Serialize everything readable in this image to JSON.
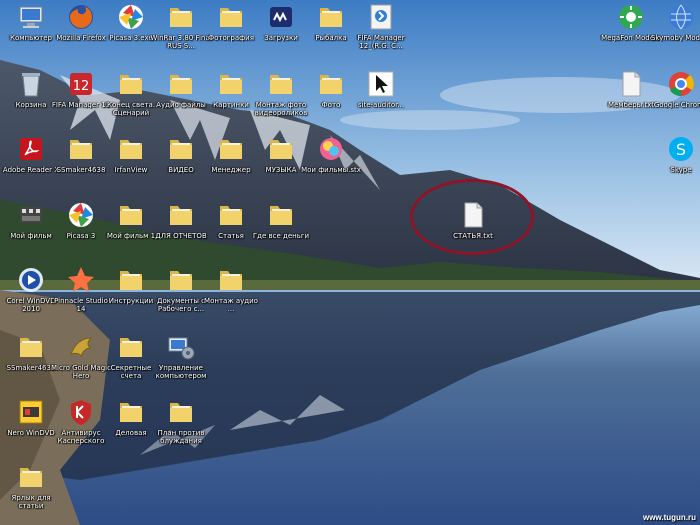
{
  "desktop": {
    "icons": [
      {
        "label": "Компьютер",
        "icon": "computer-icon"
      },
      {
        "label": "Mozilla Firefox",
        "icon": "firefox-icon"
      },
      {
        "label": "Picasa 3.exe",
        "icon": "picasa-icon"
      },
      {
        "label": "WinRar 3.80 Final RUS S...",
        "icon": "folder-icon"
      },
      {
        "label": "Фотография",
        "icon": "folder-icon"
      },
      {
        "label": "Загрузки",
        "icon": "winamp-icon"
      },
      {
        "label": "Рыбалка",
        "icon": "folder-icon"
      },
      {
        "label": "FIFA Manager 12_(R.G. C...",
        "icon": "installer-icon"
      },
      {
        "label": "MegaFon Modem",
        "icon": "megafon-icon"
      },
      {
        "label": "Skymoby Modem",
        "icon": "modem-globe-icon"
      },
      {
        "label": "Корзина",
        "icon": "recycle-bin-icon"
      },
      {
        "label": "FIFA Manager 12",
        "icon": "fifa-icon"
      },
      {
        "label": "Конец света. Сценарий",
        "icon": "folder-icon"
      },
      {
        "label": "Аудио файлы",
        "icon": "folder-icon"
      },
      {
        "label": "Картинки",
        "icon": "folder-icon"
      },
      {
        "label": "Монтаж фото видеороликов",
        "icon": "folder-icon"
      },
      {
        "label": "Фото",
        "icon": "folder-icon"
      },
      {
        "label": "site-auditor...",
        "icon": "cursor-icon"
      },
      {
        "label": "Мемберы.txt",
        "icon": "text-file-icon"
      },
      {
        "label": "Google Chrome",
        "icon": "chrome-icon"
      },
      {
        "label": "Adobe Reader X",
        "icon": "adobe-reader-icon"
      },
      {
        "label": "SSmaker4638",
        "icon": "folder-icon"
      },
      {
        "label": "IrfanView",
        "icon": "folder-icon"
      },
      {
        "label": "ВИДЕО",
        "icon": "folder-icon"
      },
      {
        "label": "Менеджер",
        "icon": "folder-icon"
      },
      {
        "label": "МУЗЫКА",
        "icon": "folder-icon"
      },
      {
        "label": "Мои фильмы.stx",
        "icon": "media-file-icon"
      },
      {
        "label": "Skype",
        "icon": "skype-icon"
      },
      {
        "label": "Мой фильм",
        "icon": "movie-maker-icon"
      },
      {
        "label": "Picasa 3",
        "icon": "picasa-icon"
      },
      {
        "label": "Мой фильм 1",
        "icon": "folder-icon"
      },
      {
        "label": "ДЛЯ ОТЧЕТОВ",
        "icon": "folder-icon"
      },
      {
        "label": "Статья",
        "icon": "folder-icon"
      },
      {
        "label": "Где все деньги",
        "icon": "folder-icon"
      },
      {
        "label": "СТАТЬЯ.txt",
        "icon": "text-file-icon"
      },
      {
        "label": "Corel WinDVD 2010",
        "icon": "windvd-icon"
      },
      {
        "label": "Pinnacle Studio 14",
        "icon": "pinnacle-icon"
      },
      {
        "label": "Инструкции",
        "icon": "folder-icon"
      },
      {
        "label": "Документы с Рабочего с...",
        "icon": "folder-icon"
      },
      {
        "label": "Монтаж аудио ...",
        "icon": "folder-icon"
      },
      {
        "label": "SSmaker4638",
        "icon": "folder-icon"
      },
      {
        "label": "Micro Gold Magic Hero",
        "icon": "dragon-icon"
      },
      {
        "label": "Секретные счета",
        "icon": "folder-icon"
      },
      {
        "label": "Управление компьютером",
        "icon": "computer-management-icon"
      },
      {
        "label": "Nero WinDVD",
        "icon": "nero-icon"
      },
      {
        "label": "Антивирус Касперского",
        "icon": "kaspersky-icon"
      },
      {
        "label": "Деловая",
        "icon": "folder-icon"
      },
      {
        "label": "План против блуждания",
        "icon": "folder-icon"
      },
      {
        "label": "Ярлык для статьи",
        "icon": "folder-icon"
      }
    ]
  },
  "watermark": "www.tugun.ru"
}
